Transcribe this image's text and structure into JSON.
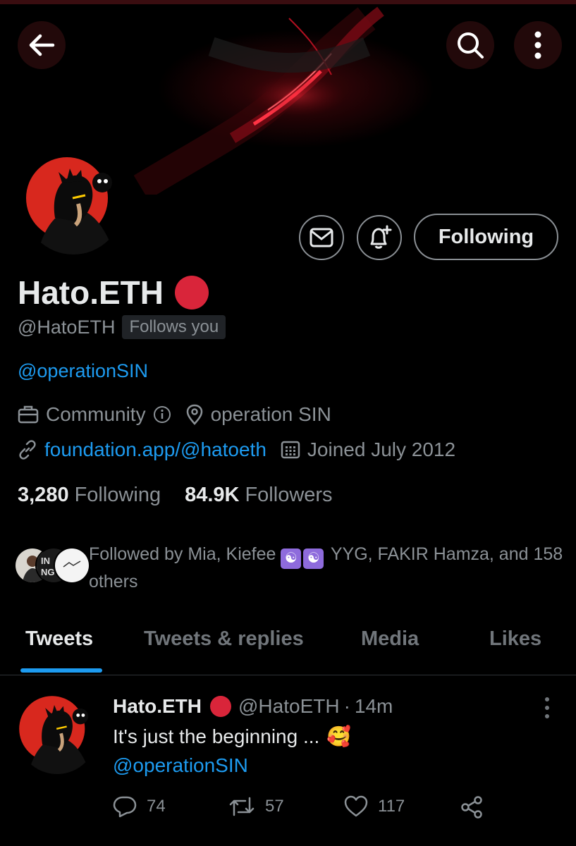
{
  "profile": {
    "display_name": "Hato.ETH",
    "handle": "@HatoETH",
    "follows_you": "Follows you",
    "bio_mention": "@operationSIN",
    "category": "Community",
    "location": "operation SIN",
    "website": "foundation.app/@hatoeth",
    "joined": "Joined July 2012",
    "following_count": "3,280",
    "following_label": "Following",
    "followers_count": "84.9K",
    "followers_label": "Followers",
    "verified_badge_color": "#d9253a"
  },
  "actions": {
    "following_button": "Following",
    "message_icon": "mail-icon",
    "notify_icon": "bell-plus-icon"
  },
  "nav": {
    "back_icon": "arrow-left-icon",
    "search_icon": "search-icon",
    "more_icon": "vertical-dots-icon"
  },
  "followed_by": {
    "prefix": "Followed by Mia, Kiefee",
    "suffix": "YYG, FAKIR Hamza, and 158 others",
    "emoji": "☯"
  },
  "tabs": [
    {
      "label": "Tweets",
      "active": true
    },
    {
      "label": "Tweets & replies",
      "active": false
    },
    {
      "label": "Media",
      "active": false
    },
    {
      "label": "Likes",
      "active": false
    }
  ],
  "tweet": {
    "name": "Hato.ETH",
    "handle": "@HatoETH",
    "separator": "·",
    "time": "14m",
    "text": "It's just the beginning ...",
    "emoji": "🥰",
    "mention": "@operationSIN",
    "replies": "74",
    "retweets": "57",
    "likes": "117"
  },
  "colors": {
    "accent": "#1d9bf0",
    "background": "#000000",
    "muted_text": "#8b9196",
    "badge_red": "#d9253a"
  }
}
